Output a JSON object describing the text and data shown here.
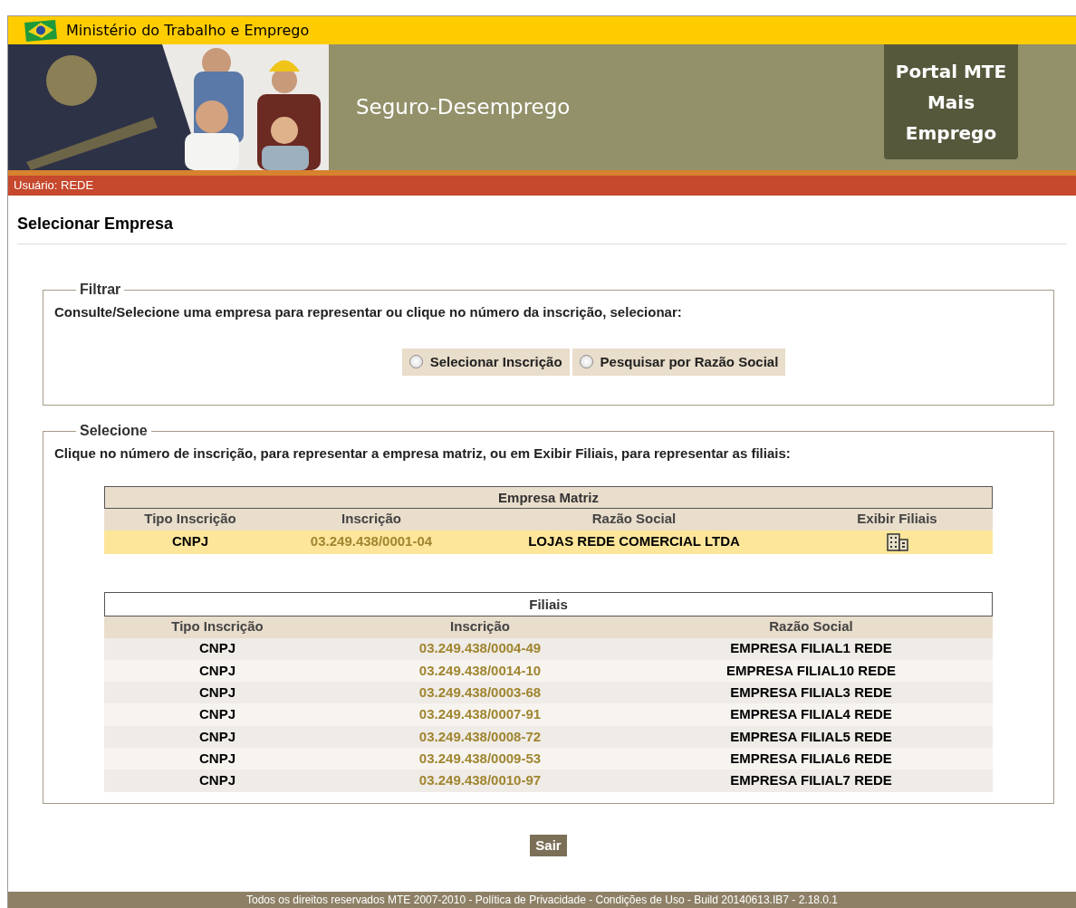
{
  "header": {
    "ministry": "Ministério do Trabalho e Emprego",
    "title": "Seguro-Desemprego",
    "portal_lines": [
      "Portal MTE",
      "Mais",
      "Emprego"
    ],
    "user": "Usuário: REDE"
  },
  "page_title": "Selecionar Empresa",
  "filter": {
    "legend": "Filtrar",
    "instruction": "Consulte/Selecione uma empresa para representar ou clique no número da inscrição, selecionar:",
    "options": [
      {
        "label": "Selecionar Inscrição",
        "selected": false
      },
      {
        "label": "Pesquisar por Razão Social",
        "selected": false
      }
    ]
  },
  "select": {
    "legend": "Selecione",
    "instruction": "Clique no número de inscrição, para representar a empresa matriz, ou em Exibir Filiais, para representar as filiais:",
    "matriz": {
      "caption": "Empresa Matriz",
      "columns": [
        "Tipo Inscrição",
        "Inscrição",
        "Razão Social",
        "Exibir Filiais"
      ],
      "rows": [
        {
          "tipo": "CNPJ",
          "inscricao": "03.249.438/0001-04",
          "razao": "LOJAS REDE COMERCIAL LTDA"
        }
      ]
    },
    "filiais": {
      "caption": "Filiais",
      "columns": [
        "Tipo Inscrição",
        "Inscrição",
        "Razão Social"
      ],
      "rows": [
        {
          "tipo": "CNPJ",
          "inscricao": "03.249.438/0004-49",
          "razao": "EMPRESA FILIAL1 REDE"
        },
        {
          "tipo": "CNPJ",
          "inscricao": "03.249.438/0014-10",
          "razao": "EMPRESA FILIAL10 REDE"
        },
        {
          "tipo": "CNPJ",
          "inscricao": "03.249.438/0003-68",
          "razao": "EMPRESA FILIAL3 REDE"
        },
        {
          "tipo": "CNPJ",
          "inscricao": "03.249.438/0007-91",
          "razao": "EMPRESA FILIAL4 REDE"
        },
        {
          "tipo": "CNPJ",
          "inscricao": "03.249.438/0008-72",
          "razao": "EMPRESA FILIAL5 REDE"
        },
        {
          "tipo": "CNPJ",
          "inscricao": "03.249.438/0009-53",
          "razao": "EMPRESA FILIAL6 REDE"
        },
        {
          "tipo": "CNPJ",
          "inscricao": "03.249.438/0010-97",
          "razao": "EMPRESA FILIAL7 REDE"
        }
      ]
    }
  },
  "exit_button": "Sair",
  "footer": "Todos os direitos reservados MTE 2007-2010 - Política de Privacidade - Condições de Uso - Build 20140613.IB7 - 2.18.0.1"
}
